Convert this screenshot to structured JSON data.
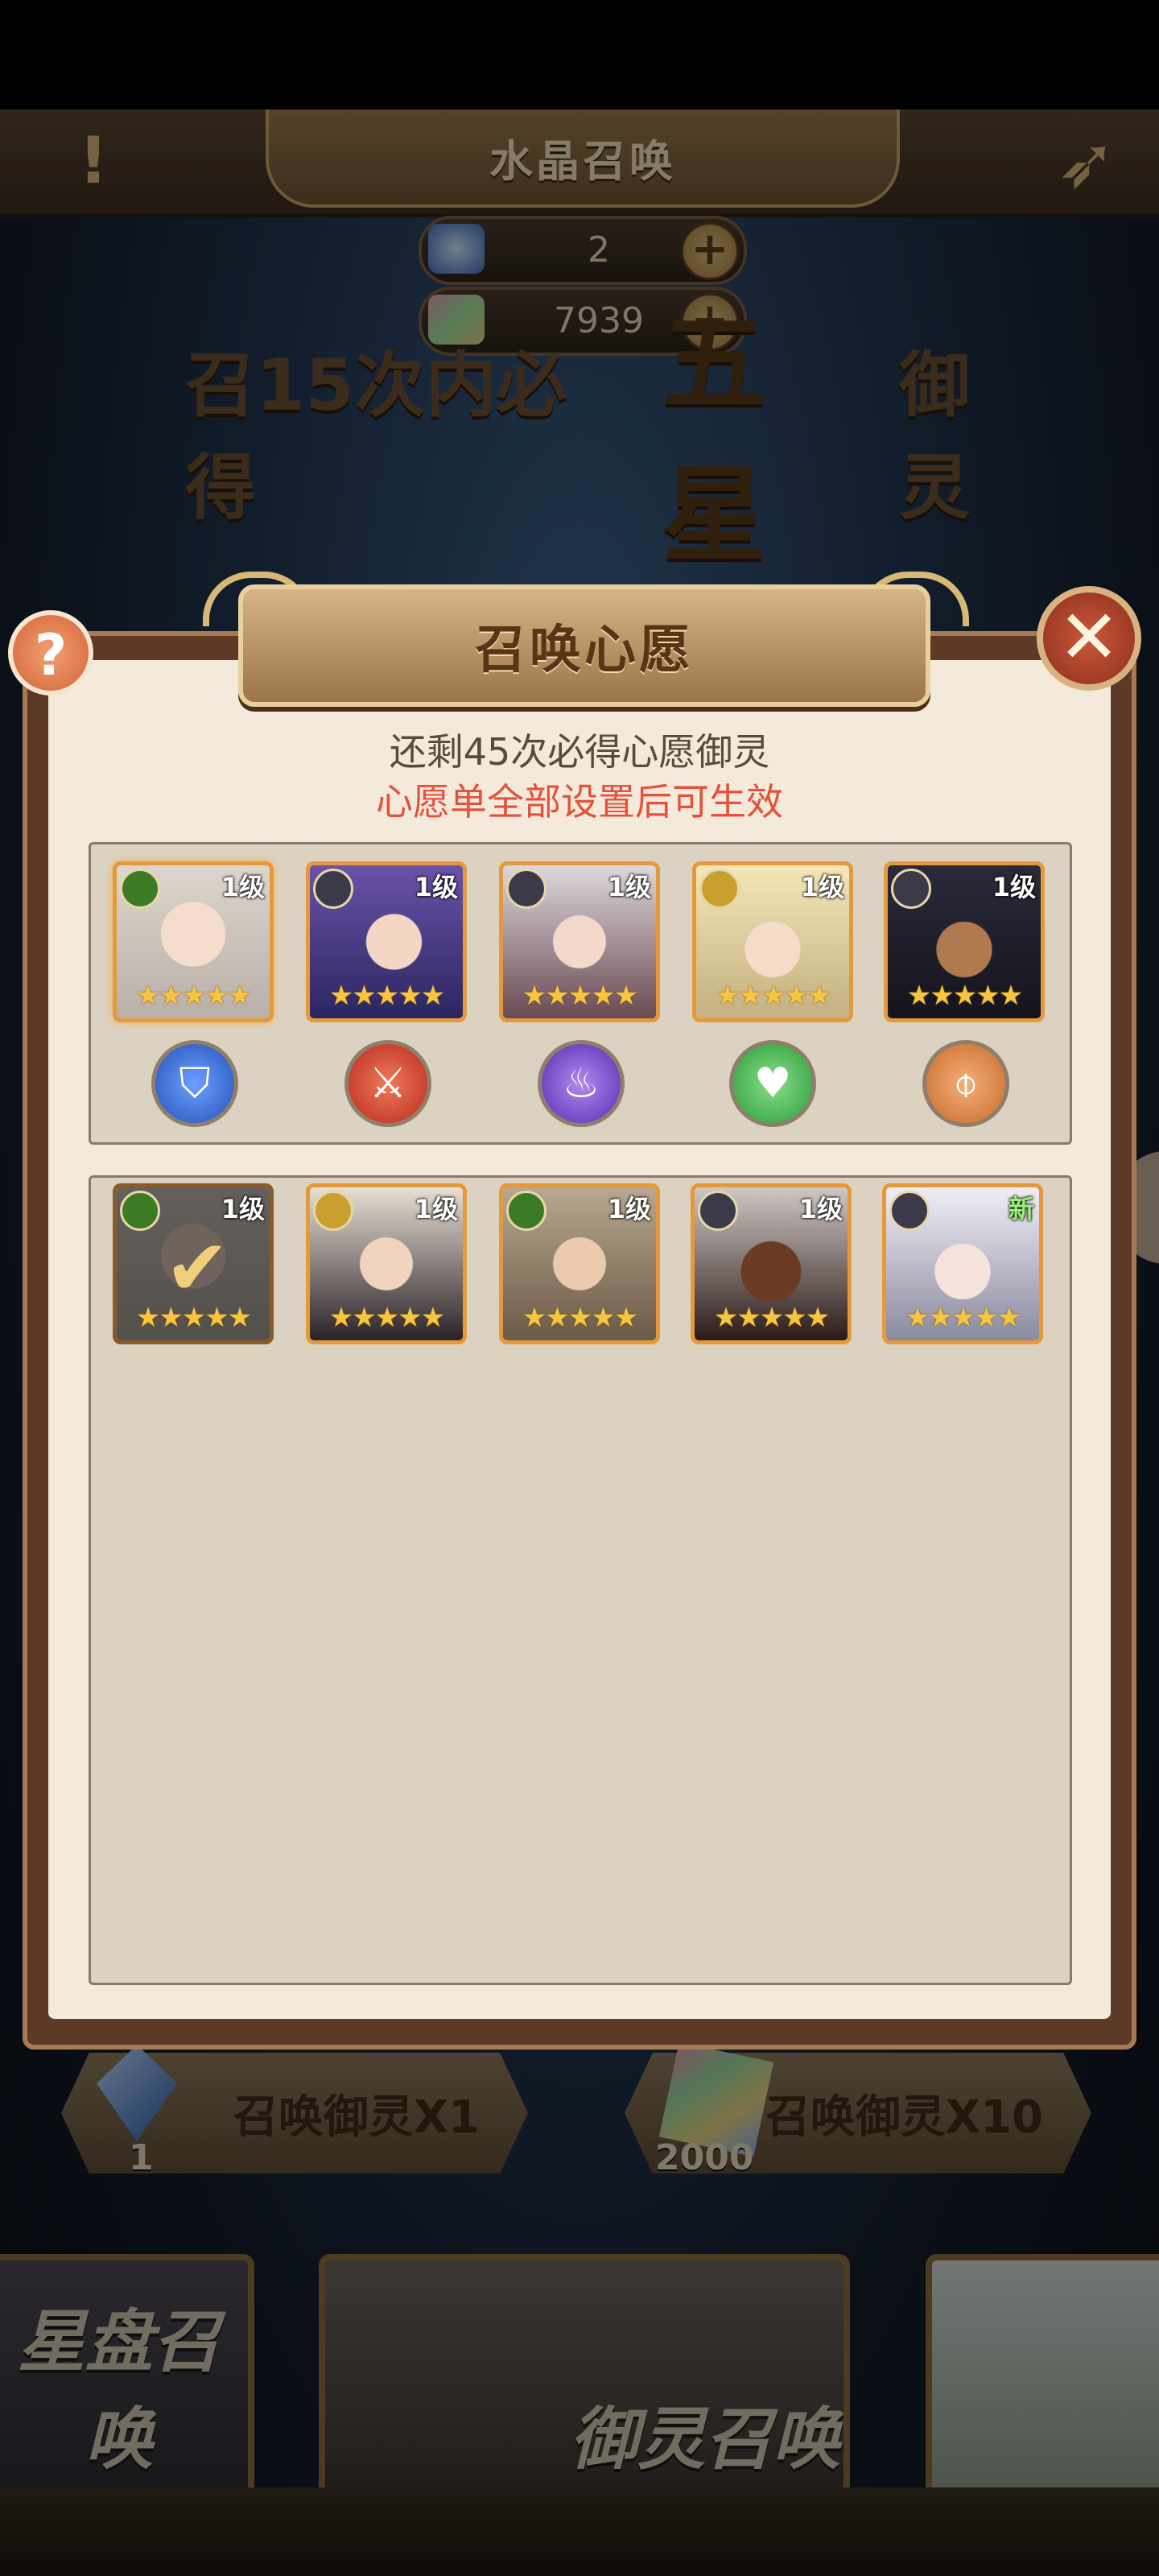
{
  "header": {
    "title": "水晶召唤"
  },
  "currency": [
    {
      "icon": "blue-crystal-icon",
      "value": "2",
      "color": "#6fa8e8"
    },
    {
      "icon": "rainbow-gem-icon",
      "value": "7939",
      "color": "#d88aa0"
    }
  ],
  "banner": {
    "part1": "召15次内必得",
    "part2": "五星",
    "part3": "御灵"
  },
  "modal": {
    "title": "召唤心愿",
    "subtitle": "还剩45次必得心愿御灵",
    "notice": "心愿单全部设置后可生效",
    "help_label": "?",
    "close_label": "✕"
  },
  "wish_list": [
    {
      "level": "1级",
      "faction": "green",
      "element": "shield",
      "stars": "★★★★★"
    },
    {
      "level": "1级",
      "faction": "dark",
      "element": "sword",
      "stars": "★★★★★"
    },
    {
      "level": "1级",
      "faction": "dark",
      "element": "fire",
      "stars": "★★★★★"
    },
    {
      "level": "1级",
      "faction": "gold",
      "element": "heal",
      "stars": "★★★★★"
    },
    {
      "level": "1级",
      "faction": "dark",
      "element": "wind",
      "stars": "★★★★★"
    }
  ],
  "candidates": [
    {
      "level": "1级",
      "faction": "green",
      "selected": true,
      "stars": "★★★★★"
    },
    {
      "level": "1级",
      "faction": "gold",
      "selected": false,
      "stars": "★★★★★"
    },
    {
      "level": "1级",
      "faction": "green",
      "selected": false,
      "stars": "★★★★★"
    },
    {
      "level": "1级",
      "faction": "dark",
      "selected": false,
      "stars": "★★★★★"
    },
    {
      "level": "新",
      "faction": "dark",
      "selected": false,
      "stars": "★★★★★"
    }
  ],
  "summon_buttons": [
    {
      "label": "召唤御灵X1",
      "cost": "1"
    },
    {
      "label": "召唤御灵X10",
      "cost": "2000"
    }
  ],
  "pools": [
    {
      "label": "星盘召唤"
    },
    {
      "label": "御灵召唤"
    },
    {
      "label": ""
    }
  ]
}
